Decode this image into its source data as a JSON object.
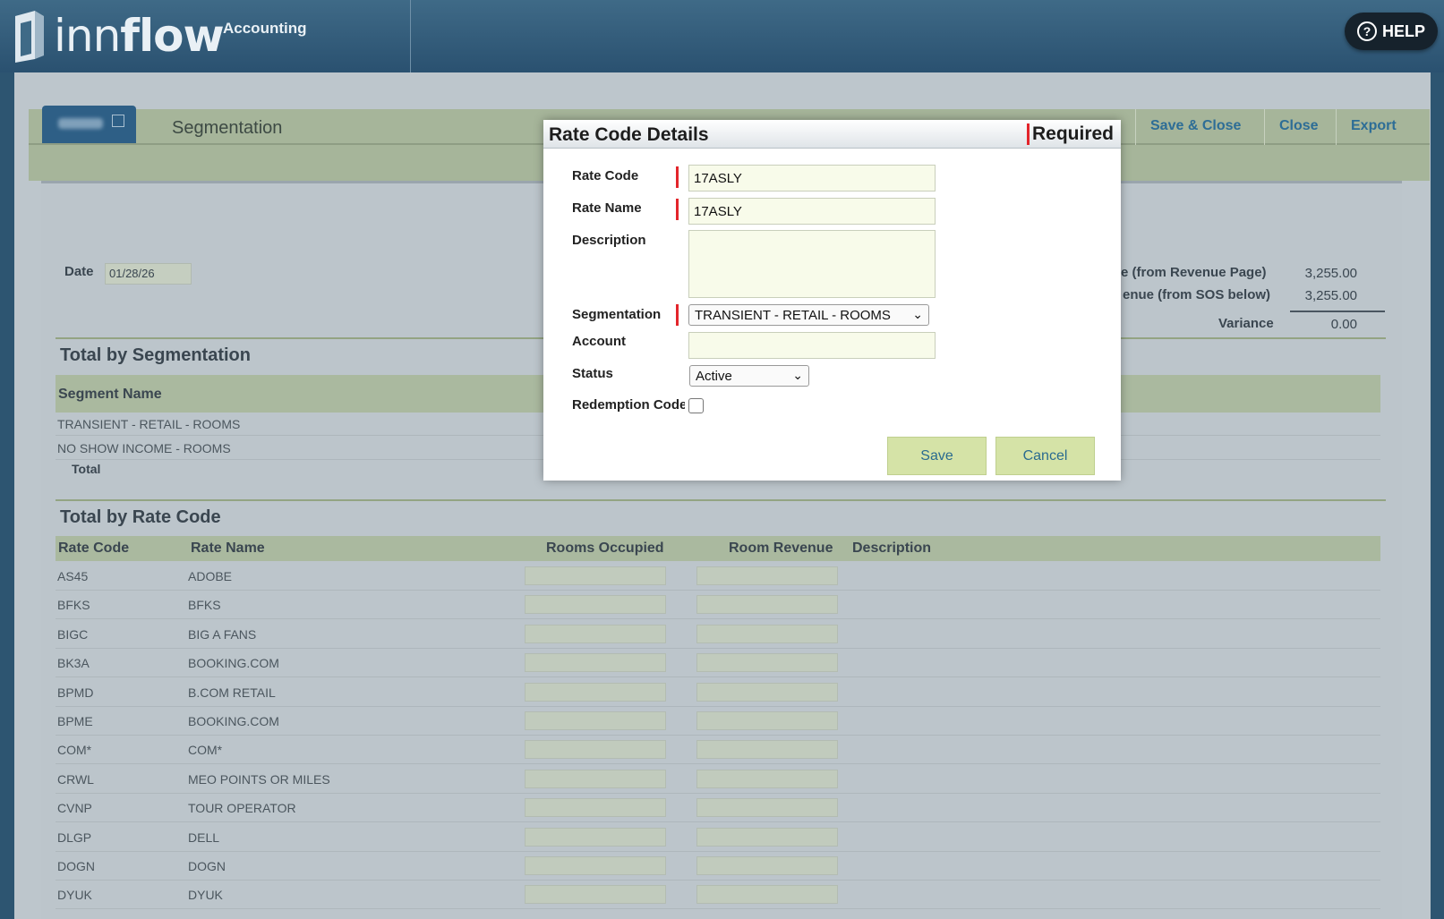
{
  "header": {
    "logo_text_light": "inn",
    "logo_text_bold": "flow",
    "app_name": "Accounting",
    "help_label": "HELP",
    "help_icon": "question-circle-icon"
  },
  "toolbar": {
    "page_title": "Segmentation",
    "links": [
      "Save & Close",
      "Close",
      "Export"
    ]
  },
  "summary": {
    "date_label": "Date",
    "date_value": "01/28/26",
    "rows": [
      {
        "label": "e (from Revenue Page)",
        "value": "3,255.00"
      },
      {
        "label": "enue (from SOS below)",
        "value": "3,255.00"
      },
      {
        "label": "Variance",
        "value": "0.00"
      }
    ]
  },
  "segmentation": {
    "title": "Total by Segmentation",
    "header": "Segment Name",
    "rows": [
      "TRANSIENT - RETAIL - ROOMS",
      "NO SHOW INCOME - ROOMS"
    ],
    "total_label": "Total"
  },
  "rate_codes": {
    "title": "Total by Rate Code",
    "headers": {
      "rate_code": "Rate Code",
      "rate_name": "Rate Name",
      "rooms_occupied": "Rooms Occupied",
      "room_revenue": "Room Revenue",
      "description": "Description"
    },
    "rows": [
      {
        "code": "AS45",
        "name": "ADOBE"
      },
      {
        "code": "BFKS",
        "name": "BFKS"
      },
      {
        "code": "BIGC",
        "name": "BIG A FANS"
      },
      {
        "code": "BK3A",
        "name": "BOOKING.COM"
      },
      {
        "code": "BPMD",
        "name": "B.COM RETAIL"
      },
      {
        "code": "BPME",
        "name": "BOOKING.COM"
      },
      {
        "code": "COM*",
        "name": "COM*"
      },
      {
        "code": "CRWL",
        "name": "MEO POINTS OR MILES"
      },
      {
        "code": "CVNP",
        "name": "TOUR OPERATOR"
      },
      {
        "code": "DLGP",
        "name": "DELL"
      },
      {
        "code": "DOGN",
        "name": "DOGN"
      },
      {
        "code": "DYUK",
        "name": "DYUK"
      }
    ]
  },
  "modal": {
    "title": "Rate Code Details",
    "required_label": "Required",
    "fields": {
      "rate_code_label": "Rate Code",
      "rate_code_value": "17ASLY",
      "rate_name_label": "Rate Name",
      "rate_name_value": "17ASLY",
      "description_label": "Description",
      "description_value": "",
      "segmentation_label": "Segmentation",
      "segmentation_value": "TRANSIENT - RETAIL - ROOMS",
      "account_label": "Account",
      "account_value": "",
      "status_label": "Status",
      "status_value": "Active",
      "redemption_label": "Redemption Code"
    },
    "save_label": "Save",
    "cancel_label": "Cancel"
  },
  "colors": {
    "accent_required": "#e3252b",
    "button_bg": "#d5e3a7",
    "link_blue": "#2d6d96",
    "topbar": "#2d5571"
  }
}
